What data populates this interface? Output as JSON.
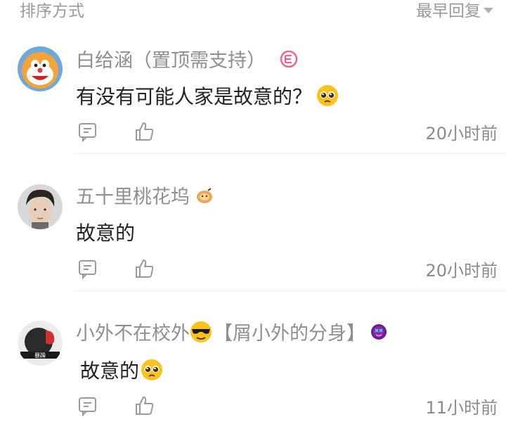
{
  "sort": {
    "label": "排序方式",
    "value": "最早回复"
  },
  "comments": [
    {
      "username": "白给涵（置顶需支持）",
      "content": "有没有可能人家是故意的？",
      "time": "20小时前"
    },
    {
      "username": "五十里桃花坞",
      "content": "故意的",
      "time": "20小时前"
    },
    {
      "username_part1": "小外不在校外",
      "username_part2": "【屑小外的分身】",
      "content": "故意的",
      "time": "11小时前"
    }
  ],
  "colors": {
    "meta_text": "#8f8f8f",
    "body_text": "#222222",
    "divider": "#ececec",
    "badge_pink": "#f06292"
  }
}
